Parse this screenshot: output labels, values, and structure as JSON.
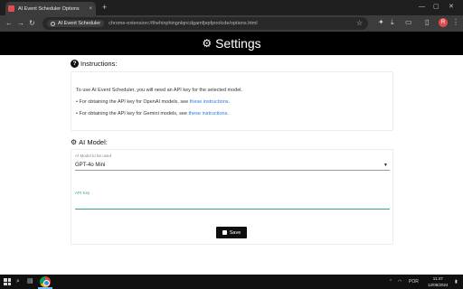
{
  "browser": {
    "tab_title": "AI Event Scheduler Options",
    "tab_close": "×",
    "new_tab": "+",
    "window_controls": [
      "—",
      "▢",
      "✕"
    ],
    "nav": [
      "←",
      "→",
      "↻"
    ],
    "site_chip": "AI Event Scheduler",
    "url": "chrome-extension://thehinphingnlqncdgamfjepfpnnlcde/options.html",
    "star": "☆",
    "avatar": "R"
  },
  "header": {
    "icon": "⚙",
    "title": "Settings"
  },
  "instructions": {
    "icon": "?",
    "title": "Instructions:",
    "intro": "To use AI Event Scheduler, you will need an API key for the selected model.",
    "openai_prefix": "• For obtaining the API key for OpenAI models, see ",
    "gemini_prefix": "• For obtaining the API key for Gemini models, see ",
    "link_text": "these instructions",
    "suffix": "."
  },
  "model": {
    "icon": "⚙",
    "title": "AI Model:",
    "select_label": "AI Model to be used",
    "select_value": "GPT-4o Mini",
    "apikey_label": "API Key",
    "apikey_value": "",
    "save_label": "Save"
  },
  "taskbar": {
    "language": "POR",
    "time": "11:47",
    "date": "12/08/2024"
  }
}
